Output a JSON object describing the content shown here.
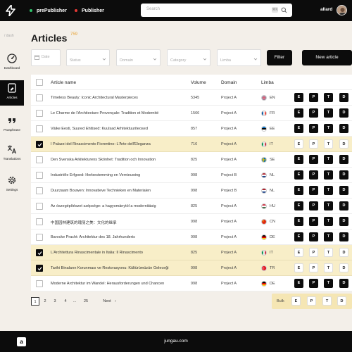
{
  "topbar": {
    "env1": "prePublisher",
    "env2": "Publisher",
    "env1_color": "#2fc46b",
    "env2_color": "#e53935",
    "search_placeholder": "Search",
    "search_shortcut": "⌘K",
    "user": "allard"
  },
  "sidebar": {
    "breadcrumb": "/ dash",
    "items": [
      {
        "label": "Dashboard",
        "icon": "dashboard-icon"
      },
      {
        "label": "Articles",
        "icon": "articles-icon",
        "active": true
      },
      {
        "label": "Paraphrase",
        "icon": "quote-icon"
      },
      {
        "label": "Translations",
        "icon": "translate-icon"
      },
      {
        "label": "Settings",
        "icon": "gear-icon"
      }
    ]
  },
  "page": {
    "title": "Articles",
    "count": "759"
  },
  "filters": {
    "date": "Date",
    "status": "Status",
    "domain": "Domain",
    "category": "Category",
    "limba": "Limba",
    "filter_button": "Filter",
    "new_button": "New article"
  },
  "table": {
    "headers": {
      "name": "Article name",
      "volume": "Volume",
      "domain": "Domain",
      "limba": "Limba"
    },
    "actions": [
      "E",
      "P",
      "T",
      "D"
    ],
    "rows": [
      {
        "name": "Timeless Beauty: Iconic Architectural Masterpieces",
        "volume": "5345",
        "domain": "Project A",
        "lang": "EN",
        "flag": "uk",
        "selected": false
      },
      {
        "name": "Le Charme de l'Architecture Provençale: Tradition et Modernité",
        "volume": "1566",
        "domain": "Project A",
        "lang": "FR",
        "flag": "fr",
        "selected": false
      },
      {
        "name": "Väike Eesti, Suured Ehitised: Kuulsad Arhitektuuriteosed",
        "volume": "857",
        "domain": "Project A",
        "lang": "EE",
        "flag": "ee",
        "selected": false
      },
      {
        "name": "I Palazzi del Rinascimento Fiorentino: L'Arte dell'Eleganza",
        "volume": "716",
        "domain": "Project A",
        "lang": "IT",
        "flag": "it",
        "selected": true
      },
      {
        "name": "Den Svenska Arkitekturens Skönhet: Tradition och Innovation",
        "volume": "825",
        "domain": "Project A",
        "lang": "SE",
        "flag": "se",
        "selected": false
      },
      {
        "name": "Industriële Erfgoed: Herbestemming en Vernieuwing",
        "volume": "998",
        "domain": "Project B",
        "lang": "NL",
        "flag": "nl",
        "selected": false
      },
      {
        "name": "Duurzaam Bouwen: Innovatieve Technieken en Materialen",
        "volume": "998",
        "domain": "Project B",
        "lang": "NL",
        "flag": "nl",
        "selected": false
      },
      {
        "name": "Az ószegépítészet szépsége: a hagyománytól a modernitásig",
        "volume": "825",
        "domain": "Project A",
        "lang": "HU",
        "flag": "hu",
        "selected": false
      },
      {
        "name": "中国园林建筑的瑰丽之美：文化的继承",
        "volume": "998",
        "domain": "Project A",
        "lang": "CN",
        "flag": "cn",
        "selected": false
      },
      {
        "name": "Barocke Pracht: Architektur des 18. Jahrhunderts",
        "volume": "998",
        "domain": "Project A",
        "lang": "DE",
        "flag": "de",
        "selected": false
      },
      {
        "name": "L'Architettura Rinascimentale in Italia: Il Rinascimento",
        "volume": "825",
        "domain": "Project A",
        "lang": "IT",
        "flag": "it",
        "selected": true
      },
      {
        "name": "Tarihi Binaların Korunması ve Restorasyonu: Kültürümüzün Geleceği",
        "volume": "998",
        "domain": "Project A",
        "lang": "TR",
        "flag": "tr",
        "selected": true
      },
      {
        "name": "Moderne Architektur im Wandel: Herausforderungen und Chancen",
        "volume": "998",
        "domain": "Project A",
        "lang": "DE",
        "flag": "de",
        "selected": false
      }
    ]
  },
  "pagination": {
    "pages": [
      "1",
      "2",
      "3",
      "4",
      "...",
      "25"
    ],
    "current": "1",
    "next": "Next"
  },
  "bulk": {
    "label": "Bulk"
  },
  "footer": {
    "url": "jungau.com",
    "logo": "a"
  }
}
